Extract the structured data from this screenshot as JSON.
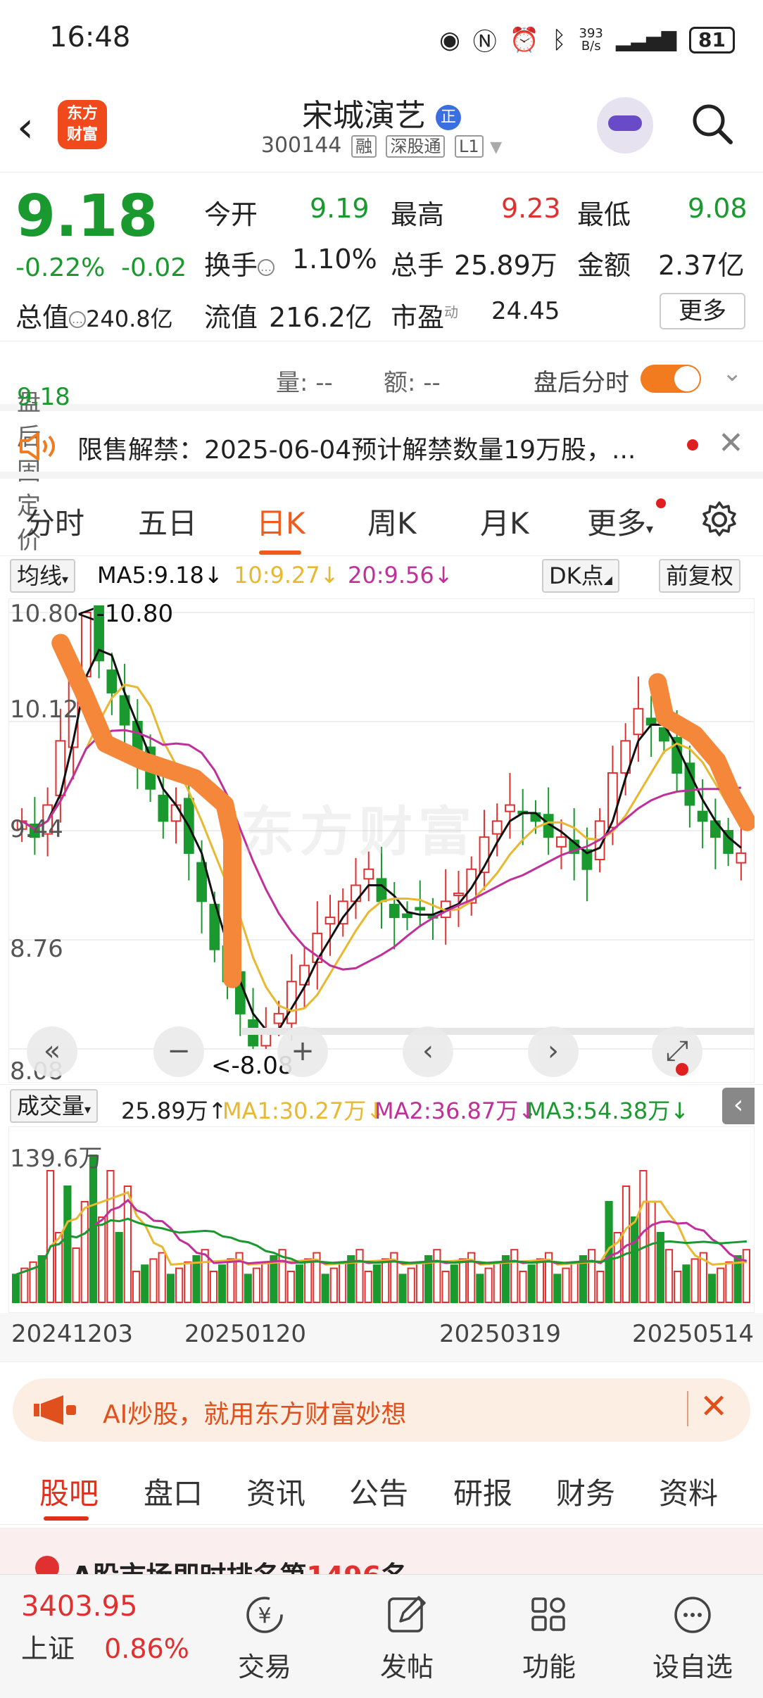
{
  "status_bar": {
    "time": "16:48",
    "net_speed_top": "393",
    "net_speed_unit": "B/s",
    "battery": "81"
  },
  "header": {
    "logo_line1": "东方",
    "logo_line2": "财富",
    "stock_name": "宋城演艺",
    "name_badge": "正",
    "stock_code": "300144",
    "tags": [
      "融",
      "深股通",
      "L1"
    ]
  },
  "quote": {
    "price": "9.18",
    "change_pct": "-0.22%",
    "change": "-0.02",
    "total_value_label": "总值",
    "total_value": "240.8亿",
    "open_label": "今开",
    "open": "9.19",
    "high_label": "最高",
    "high": "9.23",
    "low_label": "最低",
    "low": "9.08",
    "turnover_label": "换手",
    "turnover": "1.10%",
    "volume_label": "总手",
    "volume": "25.89万",
    "amount_label": "金额",
    "amount": "2.37亿",
    "float_label": "流值",
    "float_value": "216.2亿",
    "pe_label": "市盈",
    "pe_sup": "动",
    "pe": "24.45",
    "more_label": "更多"
  },
  "after_hours": {
    "price_label": "盘后固定价格:",
    "price": "9.18",
    "vol_label": "量: --",
    "amt_label": "额: --",
    "time_label": "盘后分时"
  },
  "notice": {
    "text": "限售解禁：2025-06-04预计解禁数量19万股，..."
  },
  "chart_tabs": [
    "分时",
    "五日",
    "日K",
    "周K",
    "月K",
    "更多"
  ],
  "ma_row": {
    "selector": "均线",
    "ma5": "MA5:9.18↓",
    "ma10": "10:9.27↓",
    "ma20": "20:9.56↓",
    "dk_label": "DK点",
    "adjust_label": "前复权"
  },
  "kline": {
    "y_labels": [
      "10.80",
      "10.12",
      "9.44",
      "8.76",
      "8.08"
    ],
    "max_marker": "<-10.80",
    "min_marker": "<-8.08",
    "watermark": "东方财富"
  },
  "volume_row": {
    "selector": "成交量",
    "value": "25.89万↑",
    "ma1": "MA1:30.27万↓",
    "ma2": "MA2:36.87万↓",
    "ma3": "MA3:54.38万↓",
    "max_label": "139.6万"
  },
  "dates": [
    "20241203",
    "20250120",
    "20250319",
    "20250514"
  ],
  "ai_banner": {
    "text": "AI炒股，就用东方财富妙想"
  },
  "bottom_tabs": [
    "股吧",
    "盘口",
    "资讯",
    "公告",
    "研报",
    "财务",
    "资料"
  ],
  "peek": {
    "text_prefix": "A股市场即时排名第",
    "rank": "1496",
    "text_suffix": "名"
  },
  "footer": {
    "index_value": "3403.95",
    "index_name": "上证",
    "index_change": "0.86%",
    "items": [
      "交易",
      "发帖",
      "功能",
      "设自选"
    ]
  },
  "colors": {
    "up": "#e03030",
    "down": "#1a9a2e",
    "accent": "#f05a1c",
    "ma5": "#111111",
    "ma10": "#e8b830",
    "ma20": "#c0309a",
    "annotation": "#f5873a"
  },
  "chart_data": {
    "type": "candlestick",
    "y_axis": {
      "labels": [
        10.8,
        10.12,
        9.44,
        8.76,
        8.08
      ],
      "range": [
        8.08,
        10.8
      ]
    },
    "x_ticks": [
      "20241203",
      "20250120",
      "20250319",
      "20250514"
    ],
    "closes": [
      9.5,
      9.4,
      9.6,
      10.0,
      10.4,
      10.8,
      10.5,
      10.3,
      10.1,
      9.9,
      9.7,
      9.5,
      9.6,
      9.3,
      9.0,
      8.7,
      8.5,
      8.3,
      8.1,
      8.2,
      8.3,
      8.5,
      8.6,
      8.8,
      8.9,
      9.0,
      9.1,
      9.2,
      9.0,
      8.9,
      8.9,
      8.95,
      8.9,
      9.0,
      9.05,
      9.2,
      9.4,
      9.5,
      9.6,
      9.55,
      9.5,
      9.4,
      9.4,
      9.3,
      9.2,
      9.5,
      9.8,
      10.0,
      10.2,
      10.1,
      10.0,
      9.8,
      9.6,
      9.5,
      9.4,
      9.3,
      9.3
    ],
    "ma5_last": 9.18,
    "ma10_last": 9.27,
    "ma20_last": 9.56,
    "price_high_marker": 10.8,
    "price_low_marker": 8.08,
    "volume": {
      "max_label": "139.6万",
      "last": "25.89万",
      "ma1": "30.27万",
      "ma2": "36.87万",
      "ma3": "54.38万"
    }
  }
}
